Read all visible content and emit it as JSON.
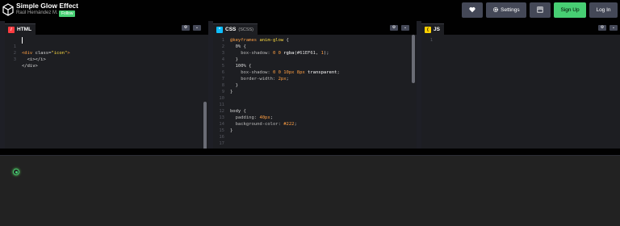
{
  "header": {
    "title": "Simple Glow Effect",
    "author": "Raúl Hernández M.",
    "follow": "Follow",
    "settings": "Settings",
    "signup": "Sign Up",
    "login": "Log In"
  },
  "editors": {
    "html": {
      "label": "HTML",
      "lines": [
        {
          "n": "1"
        },
        {
          "n": "2"
        },
        {
          "n": "3"
        }
      ]
    },
    "css": {
      "label": "CSS",
      "sublabel": "(SCSS)",
      "lines": [
        {
          "n": "1"
        },
        {
          "n": "2"
        },
        {
          "n": "3"
        },
        {
          "n": "4"
        },
        {
          "n": "5"
        },
        {
          "n": "6"
        },
        {
          "n": "7"
        },
        {
          "n": "8"
        },
        {
          "n": "9"
        },
        {
          "n": "10"
        },
        {
          "n": "11"
        },
        {
          "n": "12"
        },
        {
          "n": "13"
        },
        {
          "n": "14"
        },
        {
          "n": "15"
        },
        {
          "n": "16"
        },
        {
          "n": "17"
        }
      ]
    },
    "js": {
      "label": "JS",
      "lines": [
        {
          "n": "1"
        }
      ]
    }
  },
  "code": {
    "html": [
      [
        "<div ",
        "class",
        "=",
        "\"icon\"",
        ">"
      ],
      [
        "  <i></i>"
      ],
      [
        "</div>"
      ]
    ],
    "css": {
      "l1": [
        "@keyframes ",
        "anim-glow",
        " {"
      ],
      "l2": [
        "  0% {"
      ],
      "l3": [
        "    box-shadow: ",
        "0 0 ",
        "rgba",
        "(#61EF61, ",
        "1",
        ");"
      ],
      "l4": [
        "  }"
      ],
      "l5": [
        "  100% {"
      ],
      "l6": [
        "    box-shadow: ",
        "0 0 10px 8px ",
        "transparent",
        ";"
      ],
      "l7": [
        "    border-width: ",
        "2px",
        ";"
      ],
      "l8": [
        "  }"
      ],
      "l9": [
        "}"
      ],
      "l10": [
        ""
      ],
      "l11": [
        ""
      ],
      "l12": [
        "body {"
      ],
      "l13": [
        "  padding: ",
        "40px",
        ";"
      ],
      "l14": [
        "  background-color: ",
        "#222",
        ";"
      ],
      "l15": [
        "}"
      ],
      "l16": [
        ""
      ]
    }
  },
  "colors": {
    "accent_green": "#47cf73",
    "glow": "#61EF61",
    "html_icon": "#ff3c41",
    "css_icon": "#0ebeff",
    "js_icon": "#fcd000",
    "output_bg": "#222222"
  },
  "icons": {
    "logo": "codepen-cube-icon",
    "heart": "heart-icon",
    "settings": "gear-icon",
    "layout": "layout-icon",
    "editor_settings": "gear-icon",
    "editor_collapse": "chevron-down-icon"
  }
}
